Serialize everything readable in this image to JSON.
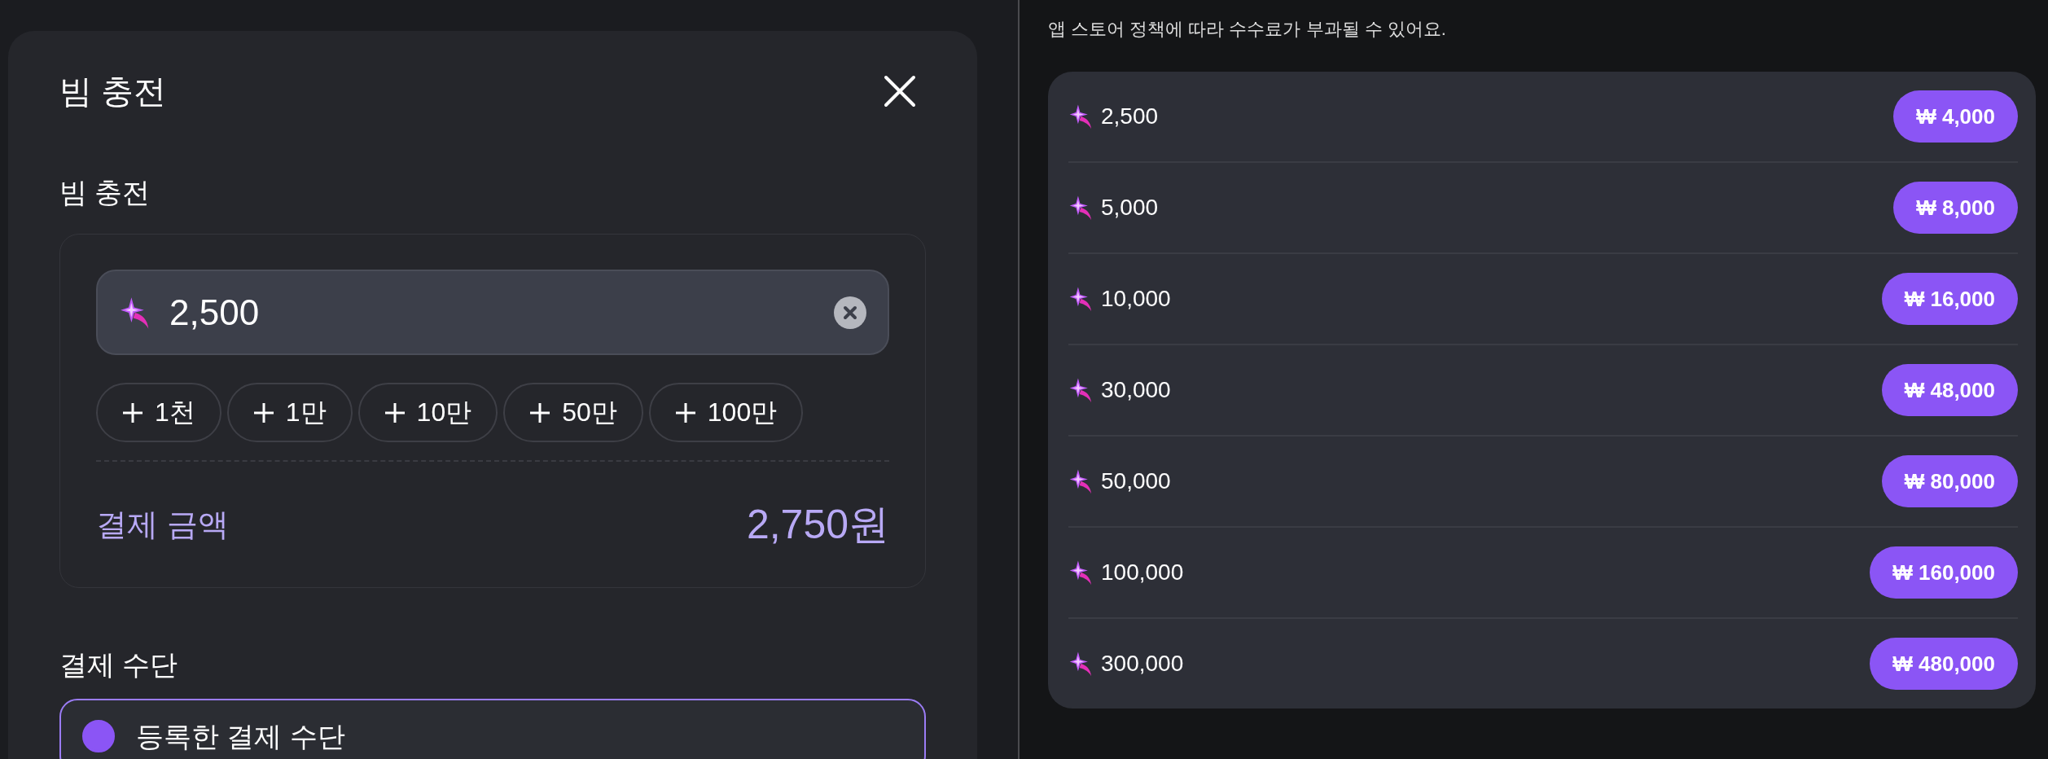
{
  "modal": {
    "title": "빔 충전",
    "section_label": "빔 충전",
    "amount_input": {
      "value": "2,500"
    },
    "quick_add": [
      {
        "label": "1천"
      },
      {
        "label": "1만"
      },
      {
        "label": "10만"
      },
      {
        "label": "50만"
      },
      {
        "label": "100만"
      }
    ],
    "payment_amount": {
      "label": "결제 금액",
      "value": "2,750원"
    },
    "payment_method": {
      "label": "결제 수단",
      "options": [
        {
          "label": "등록한 결제 수단",
          "selected": true
        }
      ]
    }
  },
  "store": {
    "notice": "앱 스토어 정책에 따라 수수료가 부과될 수 있어요.",
    "packages": [
      {
        "amount": "2,500",
        "price": "₩ 4,000"
      },
      {
        "amount": "5,000",
        "price": "₩ 8,000"
      },
      {
        "amount": "10,000",
        "price": "₩ 16,000"
      },
      {
        "amount": "30,000",
        "price": "₩ 48,000"
      },
      {
        "amount": "50,000",
        "price": "₩ 80,000"
      },
      {
        "amount": "100,000",
        "price": "₩ 160,000"
      },
      {
        "amount": "300,000",
        "price": "₩ 480,000"
      }
    ]
  }
}
